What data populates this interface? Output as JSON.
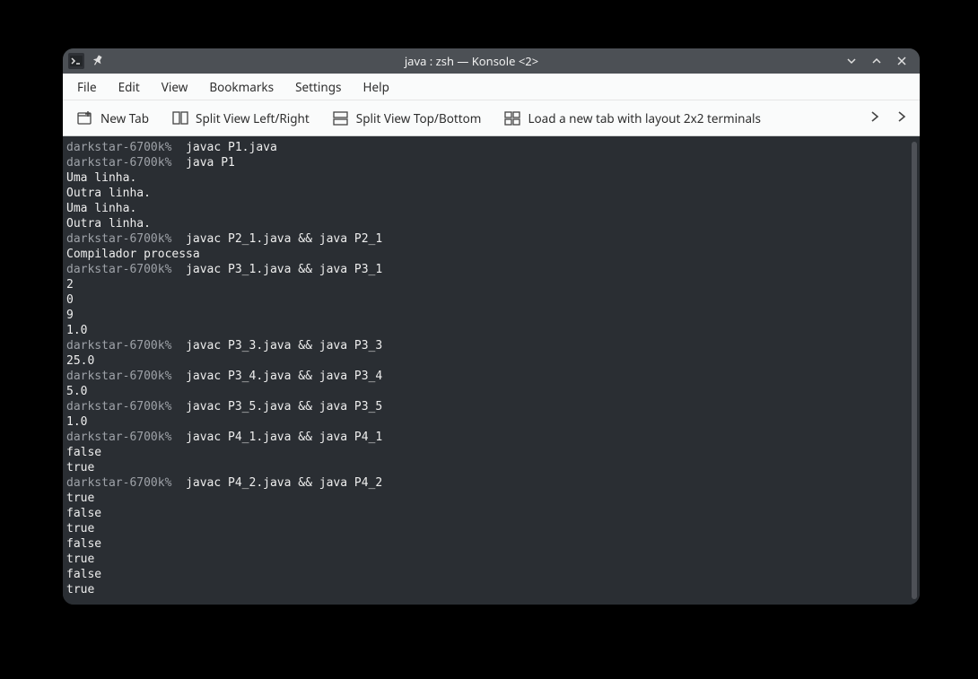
{
  "titlebar": {
    "title": "java : zsh — Konsole <2>"
  },
  "menubar": {
    "items": [
      "File",
      "Edit",
      "View",
      "Bookmarks",
      "Settings",
      "Help"
    ]
  },
  "toolbar": {
    "new_tab": "New Tab",
    "split_lr": "Split View Left/Right",
    "split_tb": "Split View Top/Bottom",
    "load_layout": "Load a new tab with layout 2x2 terminals"
  },
  "terminal": {
    "prompt": "darkstar-6700k%",
    "lines": [
      {
        "type": "cmd",
        "text": "javac P1.java"
      },
      {
        "type": "cmd",
        "text": "java P1"
      },
      {
        "type": "out",
        "text": "Uma linha."
      },
      {
        "type": "out",
        "text": "Outra linha."
      },
      {
        "type": "out",
        "text": "Uma linha."
      },
      {
        "type": "out",
        "text": "Outra linha."
      },
      {
        "type": "cmd",
        "text": "javac P2_1.java && java P2_1"
      },
      {
        "type": "out",
        "text": "Compilador processa"
      },
      {
        "type": "cmd",
        "text": "javac P3_1.java && java P3_1"
      },
      {
        "type": "out",
        "text": "2"
      },
      {
        "type": "out",
        "text": "0"
      },
      {
        "type": "out",
        "text": "9"
      },
      {
        "type": "out",
        "text": "1.0"
      },
      {
        "type": "cmd",
        "text": "javac P3_3.java && java P3_3"
      },
      {
        "type": "out",
        "text": "25.0"
      },
      {
        "type": "cmd",
        "text": "javac P3_4.java && java P3_4"
      },
      {
        "type": "out",
        "text": "5.0"
      },
      {
        "type": "cmd",
        "text": "javac P3_5.java && java P3_5"
      },
      {
        "type": "out",
        "text": "1.0"
      },
      {
        "type": "cmd",
        "text": "javac P4_1.java && java P4_1"
      },
      {
        "type": "out",
        "text": "false"
      },
      {
        "type": "out",
        "text": "true"
      },
      {
        "type": "cmd",
        "text": "javac P4_2.java && java P4_2"
      },
      {
        "type": "out",
        "text": "true"
      },
      {
        "type": "out",
        "text": "false"
      },
      {
        "type": "out",
        "text": "true"
      },
      {
        "type": "out",
        "text": "false"
      },
      {
        "type": "out",
        "text": "true"
      },
      {
        "type": "out",
        "text": "false"
      },
      {
        "type": "out",
        "text": "true"
      }
    ]
  }
}
